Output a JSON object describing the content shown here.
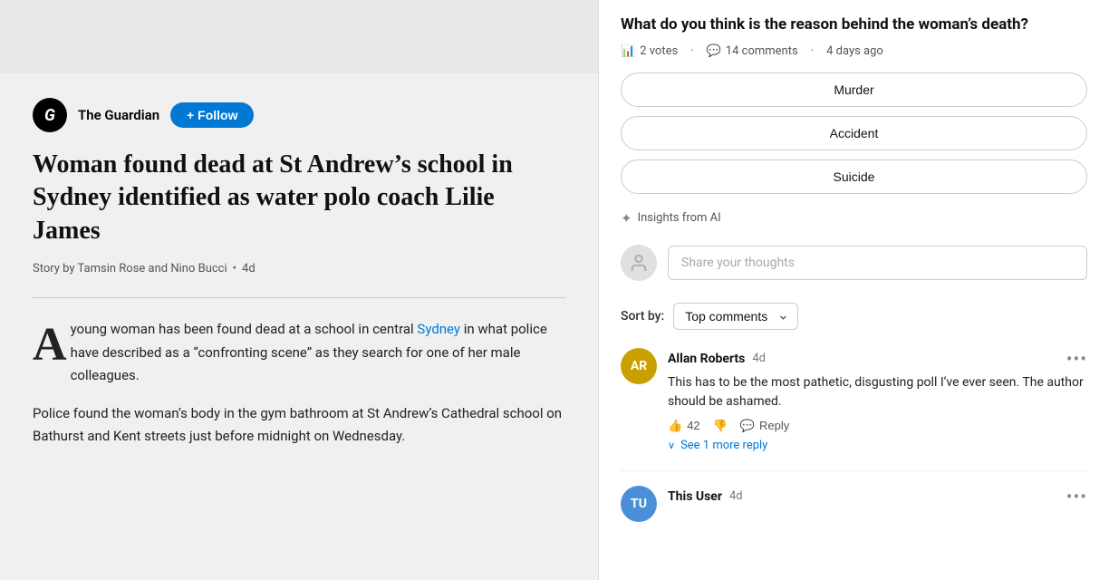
{
  "left": {
    "publisher": {
      "name": "The Guardian",
      "logo_letter": "G"
    },
    "follow_btn": "+ Follow",
    "article": {
      "title": "Woman found dead at St Andrew’s school in Sydney identified as water polo coach Lilie James",
      "meta_story_by": "Story by Tamsin Rose and Nino Bucci",
      "meta_time": "4d",
      "para1_drop": "A",
      "para1_rest": "young woman has been found dead at a school in central",
      "para1_link": "Sydney",
      "para1_end": " in what police have described as a “confronting scene” as they search for one of her male colleagues.",
      "para2": "Police found the woman’s body in the gym bathroom at St Andrew’s Cathedral school on Bathurst and Kent streets just before midnight on Wednesday."
    }
  },
  "right": {
    "poll": {
      "question_top": "What do you think is the reason behind the woman’s death?",
      "votes_count": "2 votes",
      "comments_count": "14 comments",
      "time_ago": "4 days ago",
      "options": [
        "Murder",
        "Accident",
        "Suicide"
      ]
    },
    "insights": {
      "label": "Insights from AI",
      "icon": "✦"
    },
    "share_thoughts": {
      "placeholder": "Share your thoughts"
    },
    "sort": {
      "label": "Sort by:",
      "value": "Top comments"
    },
    "comments": [
      {
        "id": "ar",
        "initials": "AR",
        "author": "Allan Roberts",
        "time": "4d",
        "text": "This has to be the most pathetic, disgusting poll I’ve ever seen. The author should be ashamed.",
        "likes": "42",
        "reply_label": "Reply",
        "see_more_label": "See 1 more reply"
      },
      {
        "id": "tu",
        "initials": "TU",
        "author": "This User",
        "time": "4d",
        "text": "",
        "likes": "",
        "reply_label": "",
        "see_more_label": ""
      }
    ]
  }
}
